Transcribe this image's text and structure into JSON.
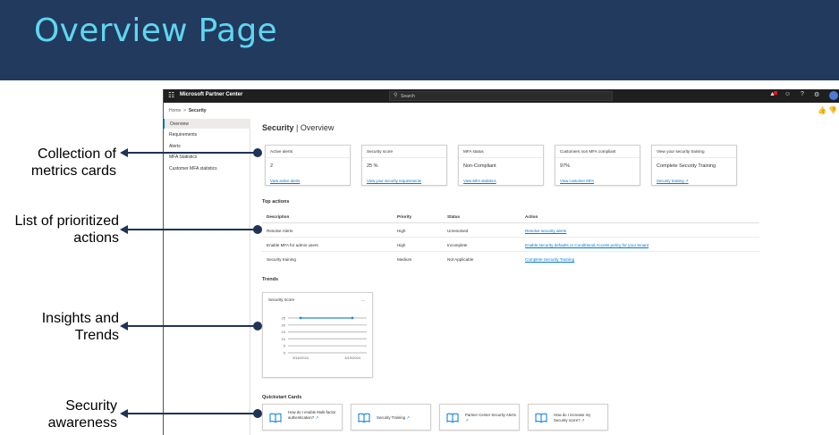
{
  "slide": {
    "title": "Overview Page"
  },
  "callouts": [
    {
      "line1": "Collection of",
      "line2": "metrics cards"
    },
    {
      "line1": "List of prioritized",
      "line2": "actions"
    },
    {
      "line1": "Insights and",
      "line2": "Trends"
    },
    {
      "line1": "Security",
      "line2": "awareness"
    }
  ],
  "topbar": {
    "app_name": "Microsoft Partner Center",
    "search_placeholder": "Search",
    "icons": [
      "waffle-icon",
      "search-icon",
      "bell-icon",
      "emoji-icon",
      "help-icon",
      "gear-icon",
      "avatar"
    ]
  },
  "breadcrumb": {
    "home": "Home",
    "separator": ">",
    "current": "Security"
  },
  "sidenav": {
    "items": [
      {
        "label": "Overview",
        "active": true
      },
      {
        "label": "Requirements",
        "active": false
      },
      {
        "label": "Alerts",
        "active": false
      },
      {
        "label": "MFA Statistics",
        "active": false
      },
      {
        "label": "Customer MFA statistics",
        "active": false
      }
    ]
  },
  "heading": {
    "primary": "Security",
    "separator": "|",
    "secondary": "Overview"
  },
  "metric_cards": [
    {
      "title": "Active alerts",
      "value": "2",
      "link": "View active alerts"
    },
    {
      "title": "Security score",
      "value": "25 %",
      "link": "View your security requirements"
    },
    {
      "title": "MFA status",
      "value": "Non-Compliant",
      "link": "View MFA statistics"
    },
    {
      "title": "Customers non MFA compliant",
      "value": "97%",
      "link": "View customer MFA"
    },
    {
      "title": "View your security training",
      "value": "Complete Security Training",
      "link": "Security training"
    }
  ],
  "top_actions": {
    "title": "Top actions",
    "columns": [
      "Description",
      "Priority",
      "Status",
      "Action"
    ],
    "rows": [
      {
        "description": "Resolve Alerts",
        "priority": "High",
        "status": "Unresolved",
        "action": "Resolve security alerts"
      },
      {
        "description": "Enable MFA for admin users",
        "priority": "High",
        "status": "Incomplete",
        "action": "Enable security defaults or Conditional Access policy for your tenant"
      },
      {
        "description": "Security training",
        "priority": "Medium",
        "status": "Not Applicable",
        "action": "Complete Security Training"
      }
    ]
  },
  "trends": {
    "title": "Trends",
    "card_title": "Security score",
    "more_label": "...",
    "chart_data": {
      "type": "line",
      "x": [
        "3/16/2024",
        "3/19/2024"
      ],
      "series": [
        {
          "values": [
            25,
            25
          ]
        }
      ],
      "yticks": [
        "25",
        "20",
        "15",
        "10",
        "5",
        "0"
      ],
      "ylim": [
        0,
        25
      ]
    }
  },
  "quickstart": {
    "title": "Quickstart Cards",
    "cards": [
      {
        "text": "How do I enable Multi-factor authentication?"
      },
      {
        "text": "Security Training"
      },
      {
        "text": "Partner Center Security Alerts"
      },
      {
        "text": "How do I increase my Security score?"
      }
    ]
  },
  "colors": {
    "banner": "#223a5e",
    "title": "#5fd6f0",
    "link": "#0078d4",
    "accent_dot": "#1f3354"
  }
}
